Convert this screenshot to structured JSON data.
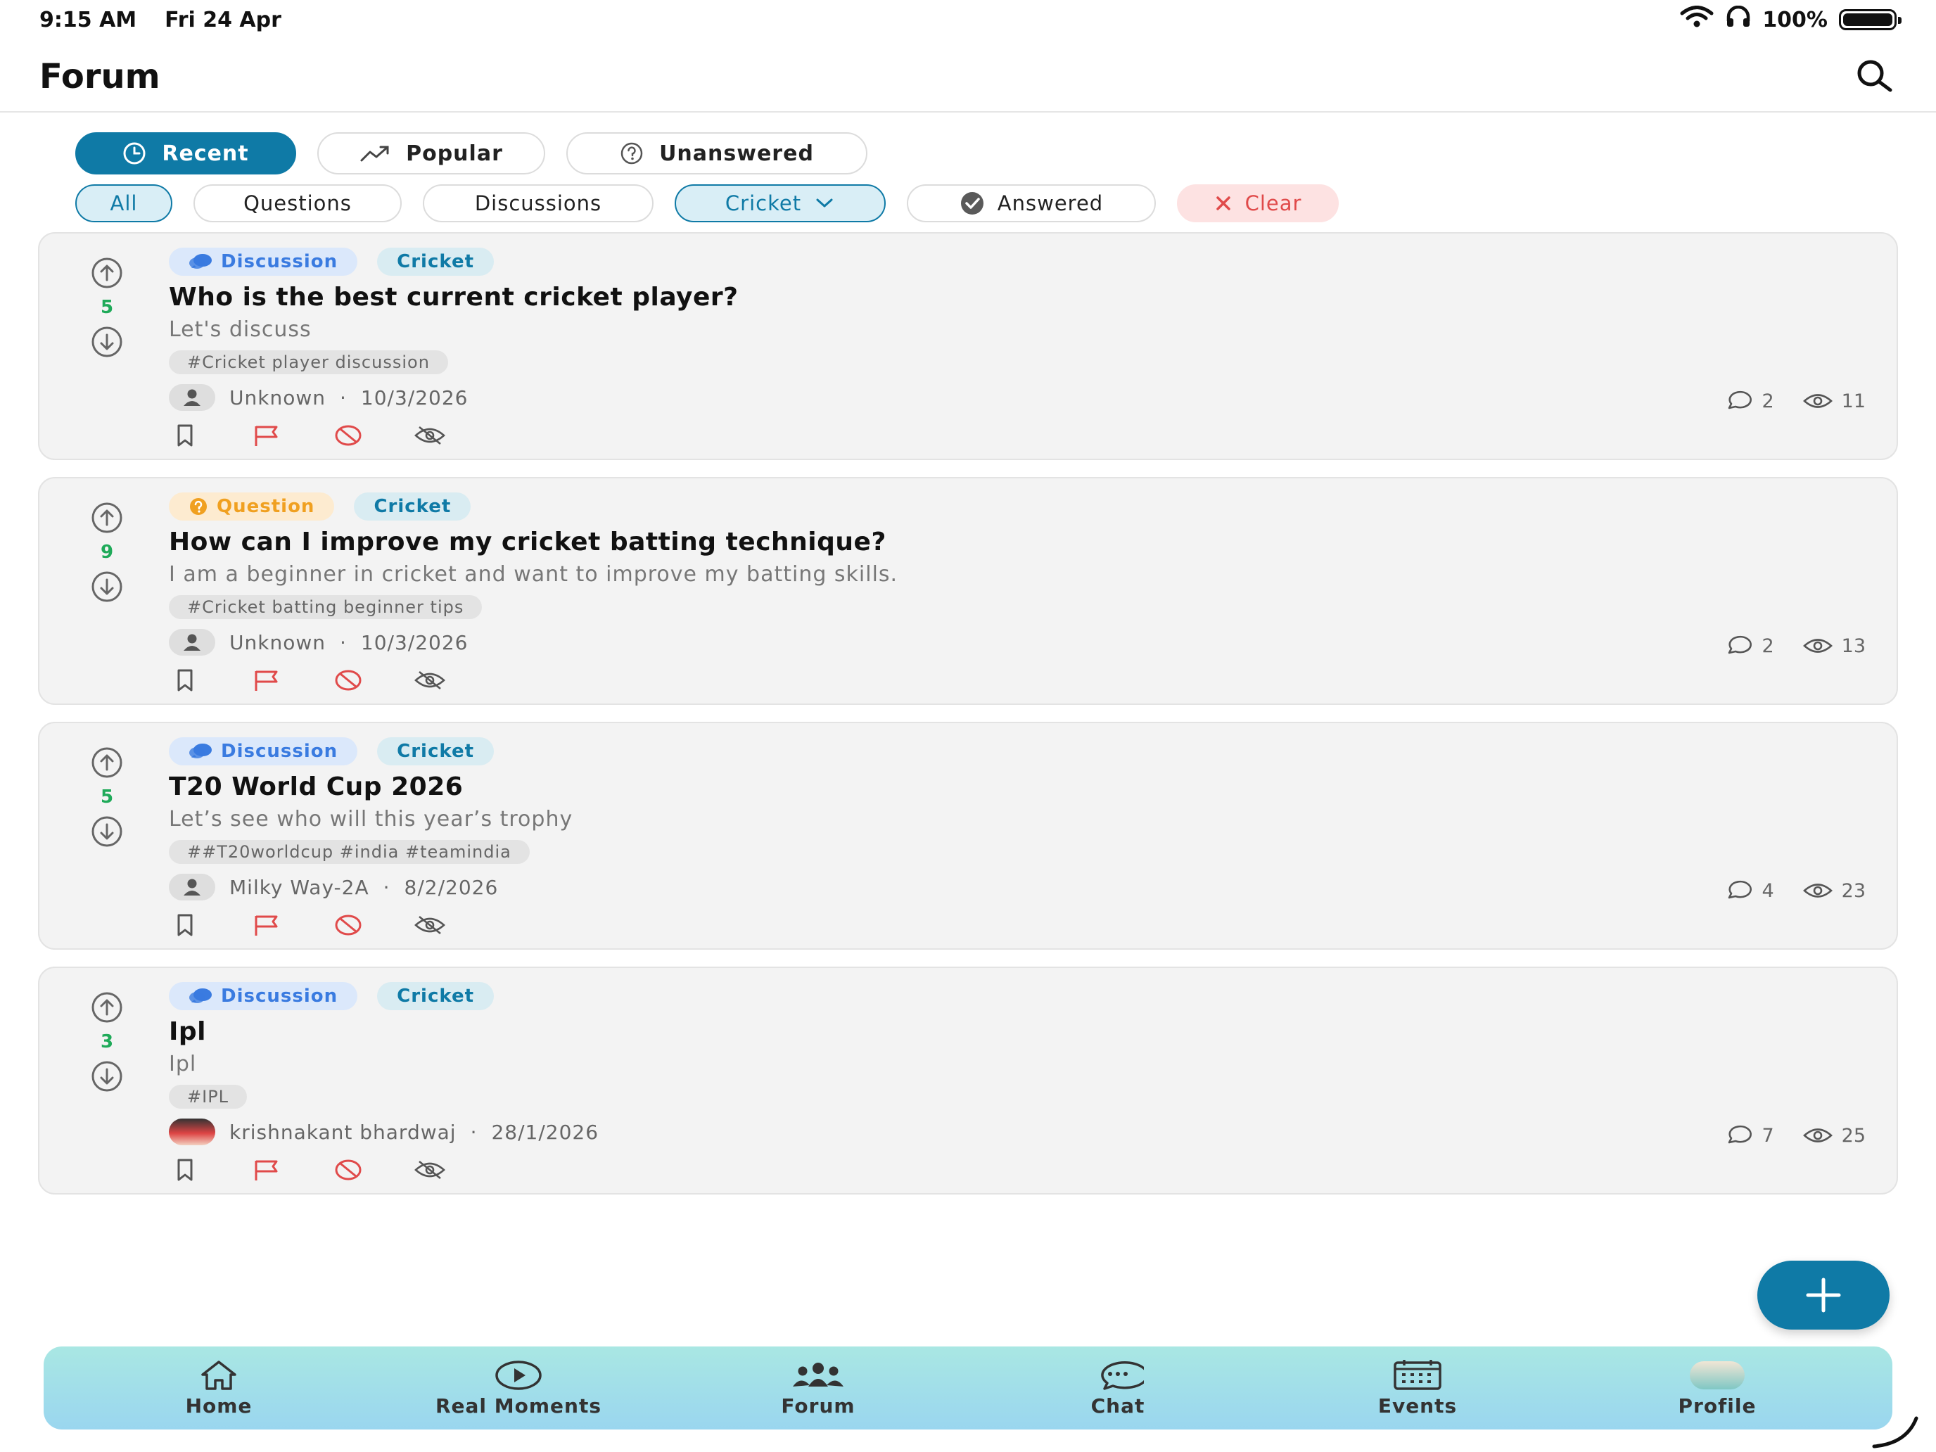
{
  "status_bar": {
    "time": "9:15 AM",
    "date": "Fri 24 Apr",
    "battery": "100%"
  },
  "header": {
    "title": "Forum"
  },
  "sort_tabs": [
    {
      "label": "Recent",
      "icon": "clock-icon",
      "active": true
    },
    {
      "label": "Popular",
      "icon": "trending-up-icon",
      "active": false
    },
    {
      "label": "Unanswered",
      "icon": "question-circle-icon",
      "active": false
    }
  ],
  "filters": {
    "all": "All",
    "questions": "Questions",
    "discussions": "Discussions",
    "category": "Cricket",
    "answered": "Answered",
    "clear": "Clear"
  },
  "posts": [
    {
      "type": "Discussion",
      "category": "Cricket",
      "votes": "5",
      "title": "Who is the best current cricket player?",
      "description": "Let's discuss",
      "tag": "#Cricket player discussion",
      "author": "Unknown",
      "date": "10/3/2026",
      "comments": "2",
      "views": "11"
    },
    {
      "type": "Question",
      "category": "Cricket",
      "votes": "9",
      "title": "How can I improve my cricket batting technique?",
      "description": "I am a beginner in cricket and want to improve my batting skills.",
      "tag": "#Cricket batting beginner tips",
      "author": "Unknown",
      "date": "10/3/2026",
      "comments": "2",
      "views": "13"
    },
    {
      "type": "Discussion",
      "category": "Cricket",
      "votes": "5",
      "title": "T20 World Cup 2026",
      "description": "Let’s see who will this year’s trophy",
      "tag": "##T20worldcup #india #teamindia",
      "author": "Milky Way-2A",
      "date": "8/2/2026",
      "comments": "4",
      "views": "23"
    },
    {
      "type": "Discussion",
      "category": "Cricket",
      "votes": "3",
      "title": "Ipl",
      "description": "Ipl",
      "tag": "#IPL",
      "author": "krishnakant bhardwaj",
      "date": "28/1/2026",
      "comments": "7",
      "views": "25"
    }
  ],
  "meta_separator": "·",
  "bottom_nav": [
    {
      "label": "Home",
      "icon": "home-icon"
    },
    {
      "label": "Real Moments",
      "icon": "play-circle-icon"
    },
    {
      "label": "Forum",
      "icon": "people-icon"
    },
    {
      "label": "Chat",
      "icon": "chat-bubble-icon"
    },
    {
      "label": "Events",
      "icon": "calendar-icon"
    },
    {
      "label": "Profile",
      "icon": "profile-avatar"
    }
  ],
  "colors": {
    "accent": "#0f7aa6",
    "upvote_count": "#1faa59",
    "flag": "#e04a4a",
    "discussion_badge": "#3a7be0",
    "question_badge": "#f0a020"
  }
}
